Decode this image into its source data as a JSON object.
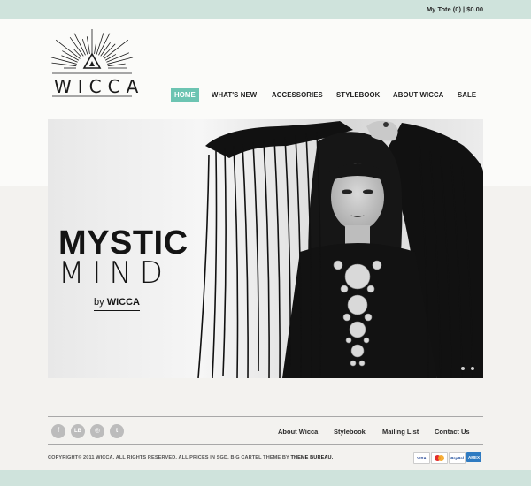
{
  "topbar": {
    "tote": "My Tote (0) | $0.00"
  },
  "logo": {
    "text": "WICCA"
  },
  "nav": {
    "items": [
      {
        "label": "HOME",
        "active": true
      },
      {
        "label": "WHAT'S NEW"
      },
      {
        "label": "ACCESSORIES"
      },
      {
        "label": "STYLEBOOK"
      },
      {
        "label": "ABOUT WICCA"
      },
      {
        "label": "SALE"
      }
    ]
  },
  "hero": {
    "title": "MYSTIC",
    "subtitle": "MIND",
    "by_prefix": "by",
    "by_brand": "WICCA"
  },
  "footer": {
    "social": [
      {
        "icon": "facebook-icon",
        "glyph": "f"
      },
      {
        "icon": "lookbook-icon",
        "glyph": "LB"
      },
      {
        "icon": "instagram-icon",
        "glyph": "◎"
      },
      {
        "icon": "tumblr-icon",
        "glyph": "t"
      }
    ],
    "links": [
      "About Wicca",
      "Stylebook",
      "Mailing List",
      "Contact Us"
    ],
    "copyright_main": "COPYRIGHT© 2011 WICCA. ALL RIGHTS RESERVED. ALL PRICES IN SGD. BIG CARTEL THEME BY",
    "copyright_credit": "THEME BUREAU.",
    "cards": [
      {
        "name": "VISA",
        "bg": "#ffffff",
        "fg": "#1a3d8f"
      },
      {
        "name": "MC",
        "bg": "#ffffff",
        "fg": "#d3262b"
      },
      {
        "name": "PayPal",
        "bg": "#ffffff",
        "fg": "#1f4e9c"
      },
      {
        "name": "AMEX",
        "bg": "#2f7bc1",
        "fg": "#ffffff"
      }
    ]
  },
  "colors": {
    "accent_bar": "#cfe3dc",
    "nav_active": "#6cc4b2",
    "page_bg": "#f3f2ef"
  }
}
